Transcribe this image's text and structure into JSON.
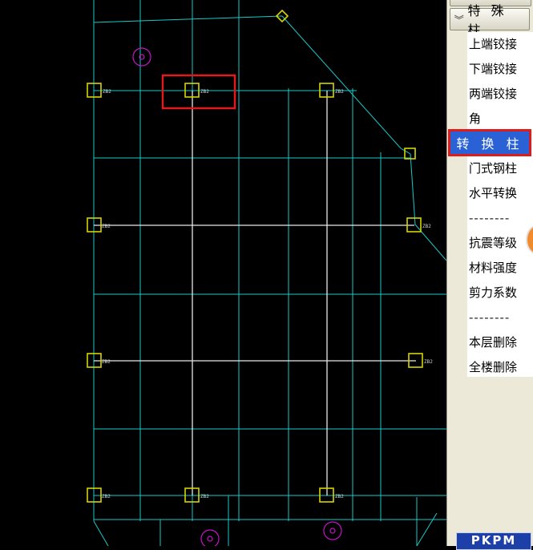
{
  "panel": {
    "header": {
      "chevron_icon": "double-chevron-down-icon",
      "label": "特 殊 柱"
    },
    "items": [
      {
        "key": "top-hinge",
        "label": "上端铰接"
      },
      {
        "key": "bottom-hinge",
        "label": "下端铰接"
      },
      {
        "key": "both-hinge",
        "label": "两端铰接"
      },
      {
        "key": "corner-column",
        "label": "角 柱"
      },
      {
        "key": "transfer-column",
        "label": "转 换 柱",
        "selected": true
      },
      {
        "key": "portal-steel-column",
        "label": "门式钢柱"
      },
      {
        "key": "horizontal-transfer",
        "label": "水平转换"
      },
      {
        "key": "sep1",
        "label": "--------"
      },
      {
        "key": "seismic-grade",
        "label": "抗震等级"
      },
      {
        "key": "material-strength",
        "label": "材料强度"
      },
      {
        "key": "shear-coefficient",
        "label": "剪力系数"
      },
      {
        "key": "sep2",
        "label": "--------"
      },
      {
        "key": "delete-floor",
        "label": "本层删除"
      },
      {
        "key": "delete-all",
        "label": "全楼删除"
      }
    ]
  },
  "logo_text": "PKPM",
  "column_tag": "ZB2",
  "colors": {
    "grid_line": "#19c9c9",
    "white_beam": "#e8e8e8",
    "column_box": "#d4d400",
    "highlight": "#e01b1b",
    "marker": "#c414c4",
    "selected_bg": "#2a62d6"
  }
}
